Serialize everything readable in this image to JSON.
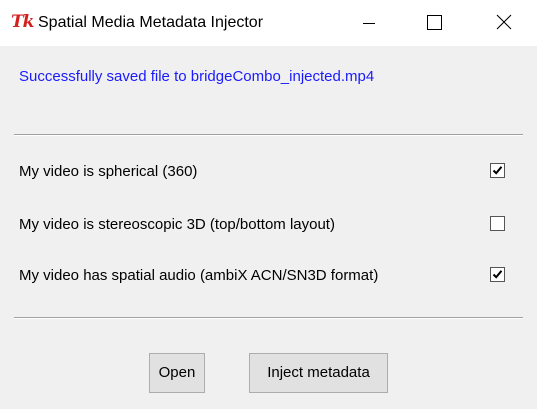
{
  "window": {
    "title": "Spatial Media Metadata Injector",
    "icon": "tk-feather-icon",
    "controls": [
      "minimize-icon",
      "maximize-icon",
      "close-icon"
    ]
  },
  "status": {
    "message": "Successfully saved file to bridgeCombo_injected.mp4",
    "color": "#1a1aff"
  },
  "options": [
    {
      "label": "My video is spherical (360)",
      "checked": true
    },
    {
      "label": "My video is stereoscopic 3D (top/bottom layout)",
      "checked": false
    },
    {
      "label": "My video has spatial audio (ambiX ACN/SN3D format)",
      "checked": true
    }
  ],
  "buttons": {
    "open_label": "Open",
    "inject_label": "Inject metadata"
  }
}
